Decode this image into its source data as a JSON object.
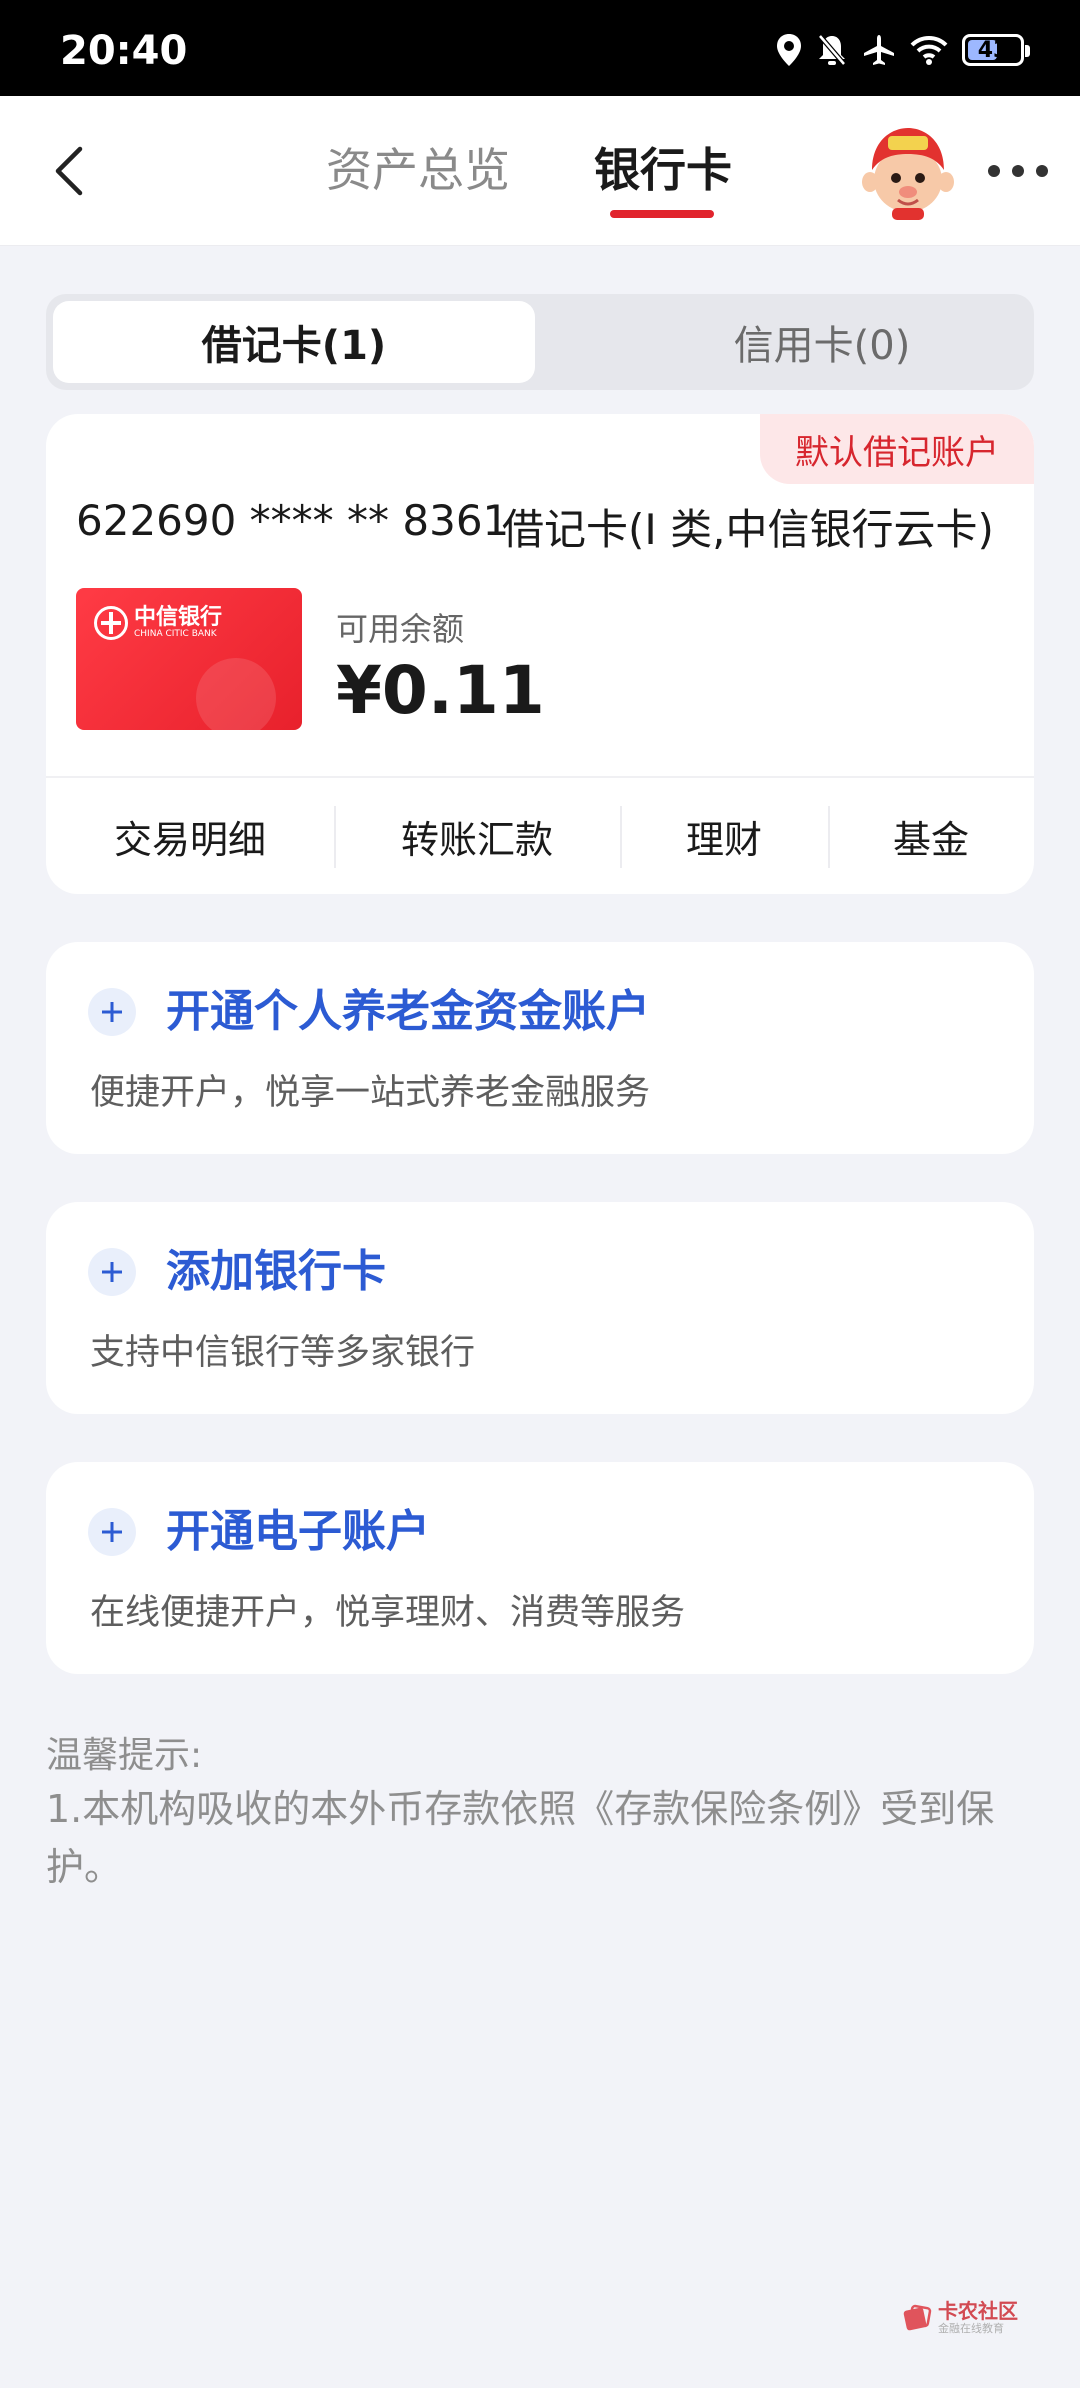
{
  "status_bar": {
    "time": "20:40",
    "battery": "43",
    "icons": [
      "location-icon",
      "bell-off-icon",
      "airplane-icon",
      "wifi-icon",
      "battery-icon"
    ]
  },
  "nav": {
    "tabs": [
      {
        "label": "资产总览",
        "active": false
      },
      {
        "label": "银行卡",
        "active": true
      }
    ],
    "accent": "#e1242d"
  },
  "segment": {
    "debit": "借记卡(1)",
    "credit": "信用卡(0)"
  },
  "debit_card": {
    "badge": "默认借记账户",
    "number": "622690 **** ** 8361",
    "type": "借记卡(I 类,中信银行云卡)",
    "bank_name": "中信银行",
    "bank_name_en": "CHINA CITIC BANK",
    "balance_label": "可用余额",
    "balance": "¥0.11",
    "actions": [
      "交易明细",
      "转账汇款",
      "理财",
      "基金"
    ]
  },
  "promos": [
    {
      "title": "开通个人养老金资金账户",
      "subtitle": "便捷开户，悦享一站式养老金融服务"
    },
    {
      "title": "添加银行卡",
      "subtitle": "支持中信银行等多家银行"
    },
    {
      "title": "开通电子账户",
      "subtitle": "在线便捷开户，悦享理财、消费等服务"
    }
  ],
  "tips": {
    "title": "温馨提示:",
    "body": "1.本机构吸收的本外币存款依照《存款保险条例》受到保护。"
  },
  "watermark": {
    "main": "卡农社区",
    "sub": "金融在线教育"
  },
  "colors": {
    "promo_title": "#2c5bd3",
    "badge_bg": "#fde7e8",
    "badge_text": "#d7262e",
    "page_bg": "#f2f3f8"
  }
}
